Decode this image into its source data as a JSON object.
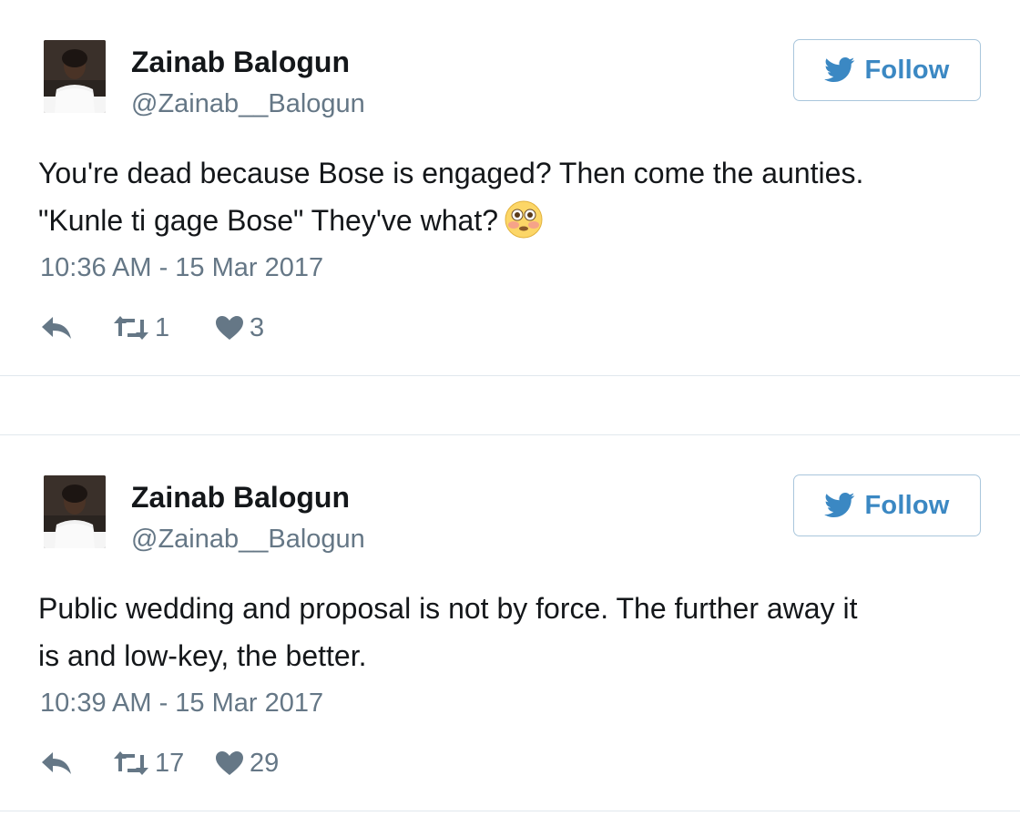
{
  "tweets": [
    {
      "author": {
        "name": "Zainab Balogun",
        "handle": "@Zainab__Balogun",
        "avatar": "profile-photo"
      },
      "follow_label": "Follow",
      "text_line1": "You're dead because Bose is engaged? Then come the aunties.",
      "text_line2": "\"Kunle ti gage Bose\" They've what?",
      "emoji": "flushed-face-icon",
      "timestamp": "10:36 AM - 15 Mar 2017",
      "retweets": "1",
      "likes": "3"
    },
    {
      "author": {
        "name": "Zainab Balogun",
        "handle": "@Zainab__Balogun",
        "avatar": "profile-photo"
      },
      "follow_label": "Follow",
      "text_line1": "Public wedding and proposal is not by force. The further away it",
      "text_line2": "is and low-key, the better.",
      "timestamp": "10:39 AM - 15 Mar 2017",
      "retweets": "17",
      "likes": "29"
    }
  ],
  "colors": {
    "text": "#14171a",
    "muted": "#657786",
    "link_blue": "#3b88c3",
    "follow_border": "#a9c6dc",
    "divider": "#e1e8ed"
  },
  "icons": {
    "bird": "twitter-bird-icon",
    "reply": "reply-icon",
    "retweet": "retweet-icon",
    "like": "heart-icon"
  }
}
